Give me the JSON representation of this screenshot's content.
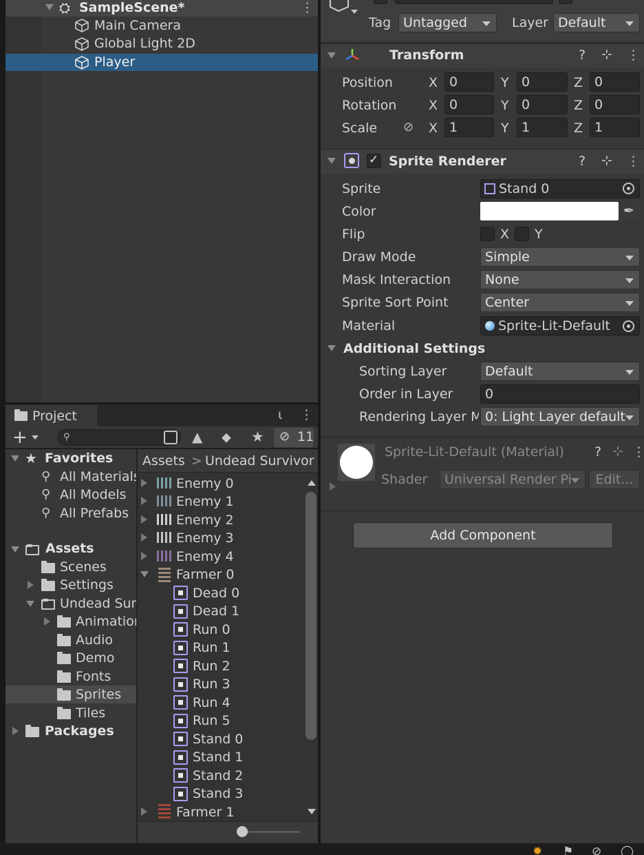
{
  "hierarchy": {
    "scene_name": "SampleScene*",
    "items": [
      "Main Camera",
      "Global Light 2D",
      "Player"
    ]
  },
  "project": {
    "tab": "Project",
    "search_placeholder": "",
    "hidden_count": "11",
    "breadcrumb": [
      "Assets",
      ">",
      "Undead Survivor"
    ],
    "favorites_label": "Favorites",
    "favorites": [
      "All Materials",
      "All Models",
      "All Prefabs"
    ],
    "assets_label": "Assets",
    "tree": {
      "scenes": "Scenes",
      "settings": "Settings",
      "undead": "Undead Sur",
      "animation": "Animation",
      "audio": "Audio",
      "demo": "Demo",
      "fonts": "Fonts",
      "sprites": "Sprites",
      "tiles": "Tiles"
    },
    "packages_label": "Packages",
    "files": [
      "Enemy 0",
      "Enemy 1",
      "Enemy 2",
      "Enemy 3",
      "Enemy 4",
      "Farmer 0"
    ],
    "sprites": [
      "Dead 0",
      "Dead 1",
      "Run 0",
      "Run 1",
      "Run 2",
      "Run 3",
      "Run 4",
      "Run 5",
      "Stand 0",
      "Stand 1",
      "Stand 2",
      "Stand 3"
    ],
    "last_file": "Farmer 1"
  },
  "inspector": {
    "tag_label": "Tag",
    "tag_value": "Untagged",
    "layer_label": "Layer",
    "layer_value": "Default",
    "transform": {
      "title": "Transform",
      "position_label": "Position",
      "rotation_label": "Rotation",
      "scale_label": "Scale",
      "x": "X",
      "y": "Y",
      "z": "Z",
      "position": [
        "0",
        "0",
        "0"
      ],
      "rotation": [
        "0",
        "0",
        "0"
      ],
      "scale": [
        "1",
        "1",
        "1"
      ]
    },
    "sprite_renderer": {
      "title": "Sprite Renderer",
      "sprite_label": "Sprite",
      "sprite_value": "Stand 0",
      "color_label": "Color",
      "color_value": "#ffffff",
      "flip_label": "Flip",
      "flip_x": "X",
      "flip_y": "Y",
      "draw_mode_label": "Draw Mode",
      "draw_mode_value": "Simple",
      "mask_label": "Mask Interaction",
      "mask_value": "None",
      "sort_point_label": "Sprite Sort Point",
      "sort_point_value": "Center",
      "material_label": "Material",
      "material_value": "Sprite-Lit-Default",
      "additional_label": "Additional Settings",
      "sorting_layer_label": "Sorting Layer",
      "sorting_layer_value": "Default",
      "order_label": "Order in Layer",
      "order_value": "0",
      "rendering_layer_label": "Rendering Layer M",
      "rendering_layer_value": "0: Light Layer default"
    },
    "material": {
      "title": "Sprite-Lit-Default (Material)",
      "shader_label": "Shader",
      "shader_value": "Universal Render Pi",
      "edit_label": "Edit..."
    },
    "add_component": "Add Component"
  },
  "colors": {
    "panel": "#383838",
    "selection": "#2c5d87",
    "sprite_icon": "#a99cf2"
  }
}
